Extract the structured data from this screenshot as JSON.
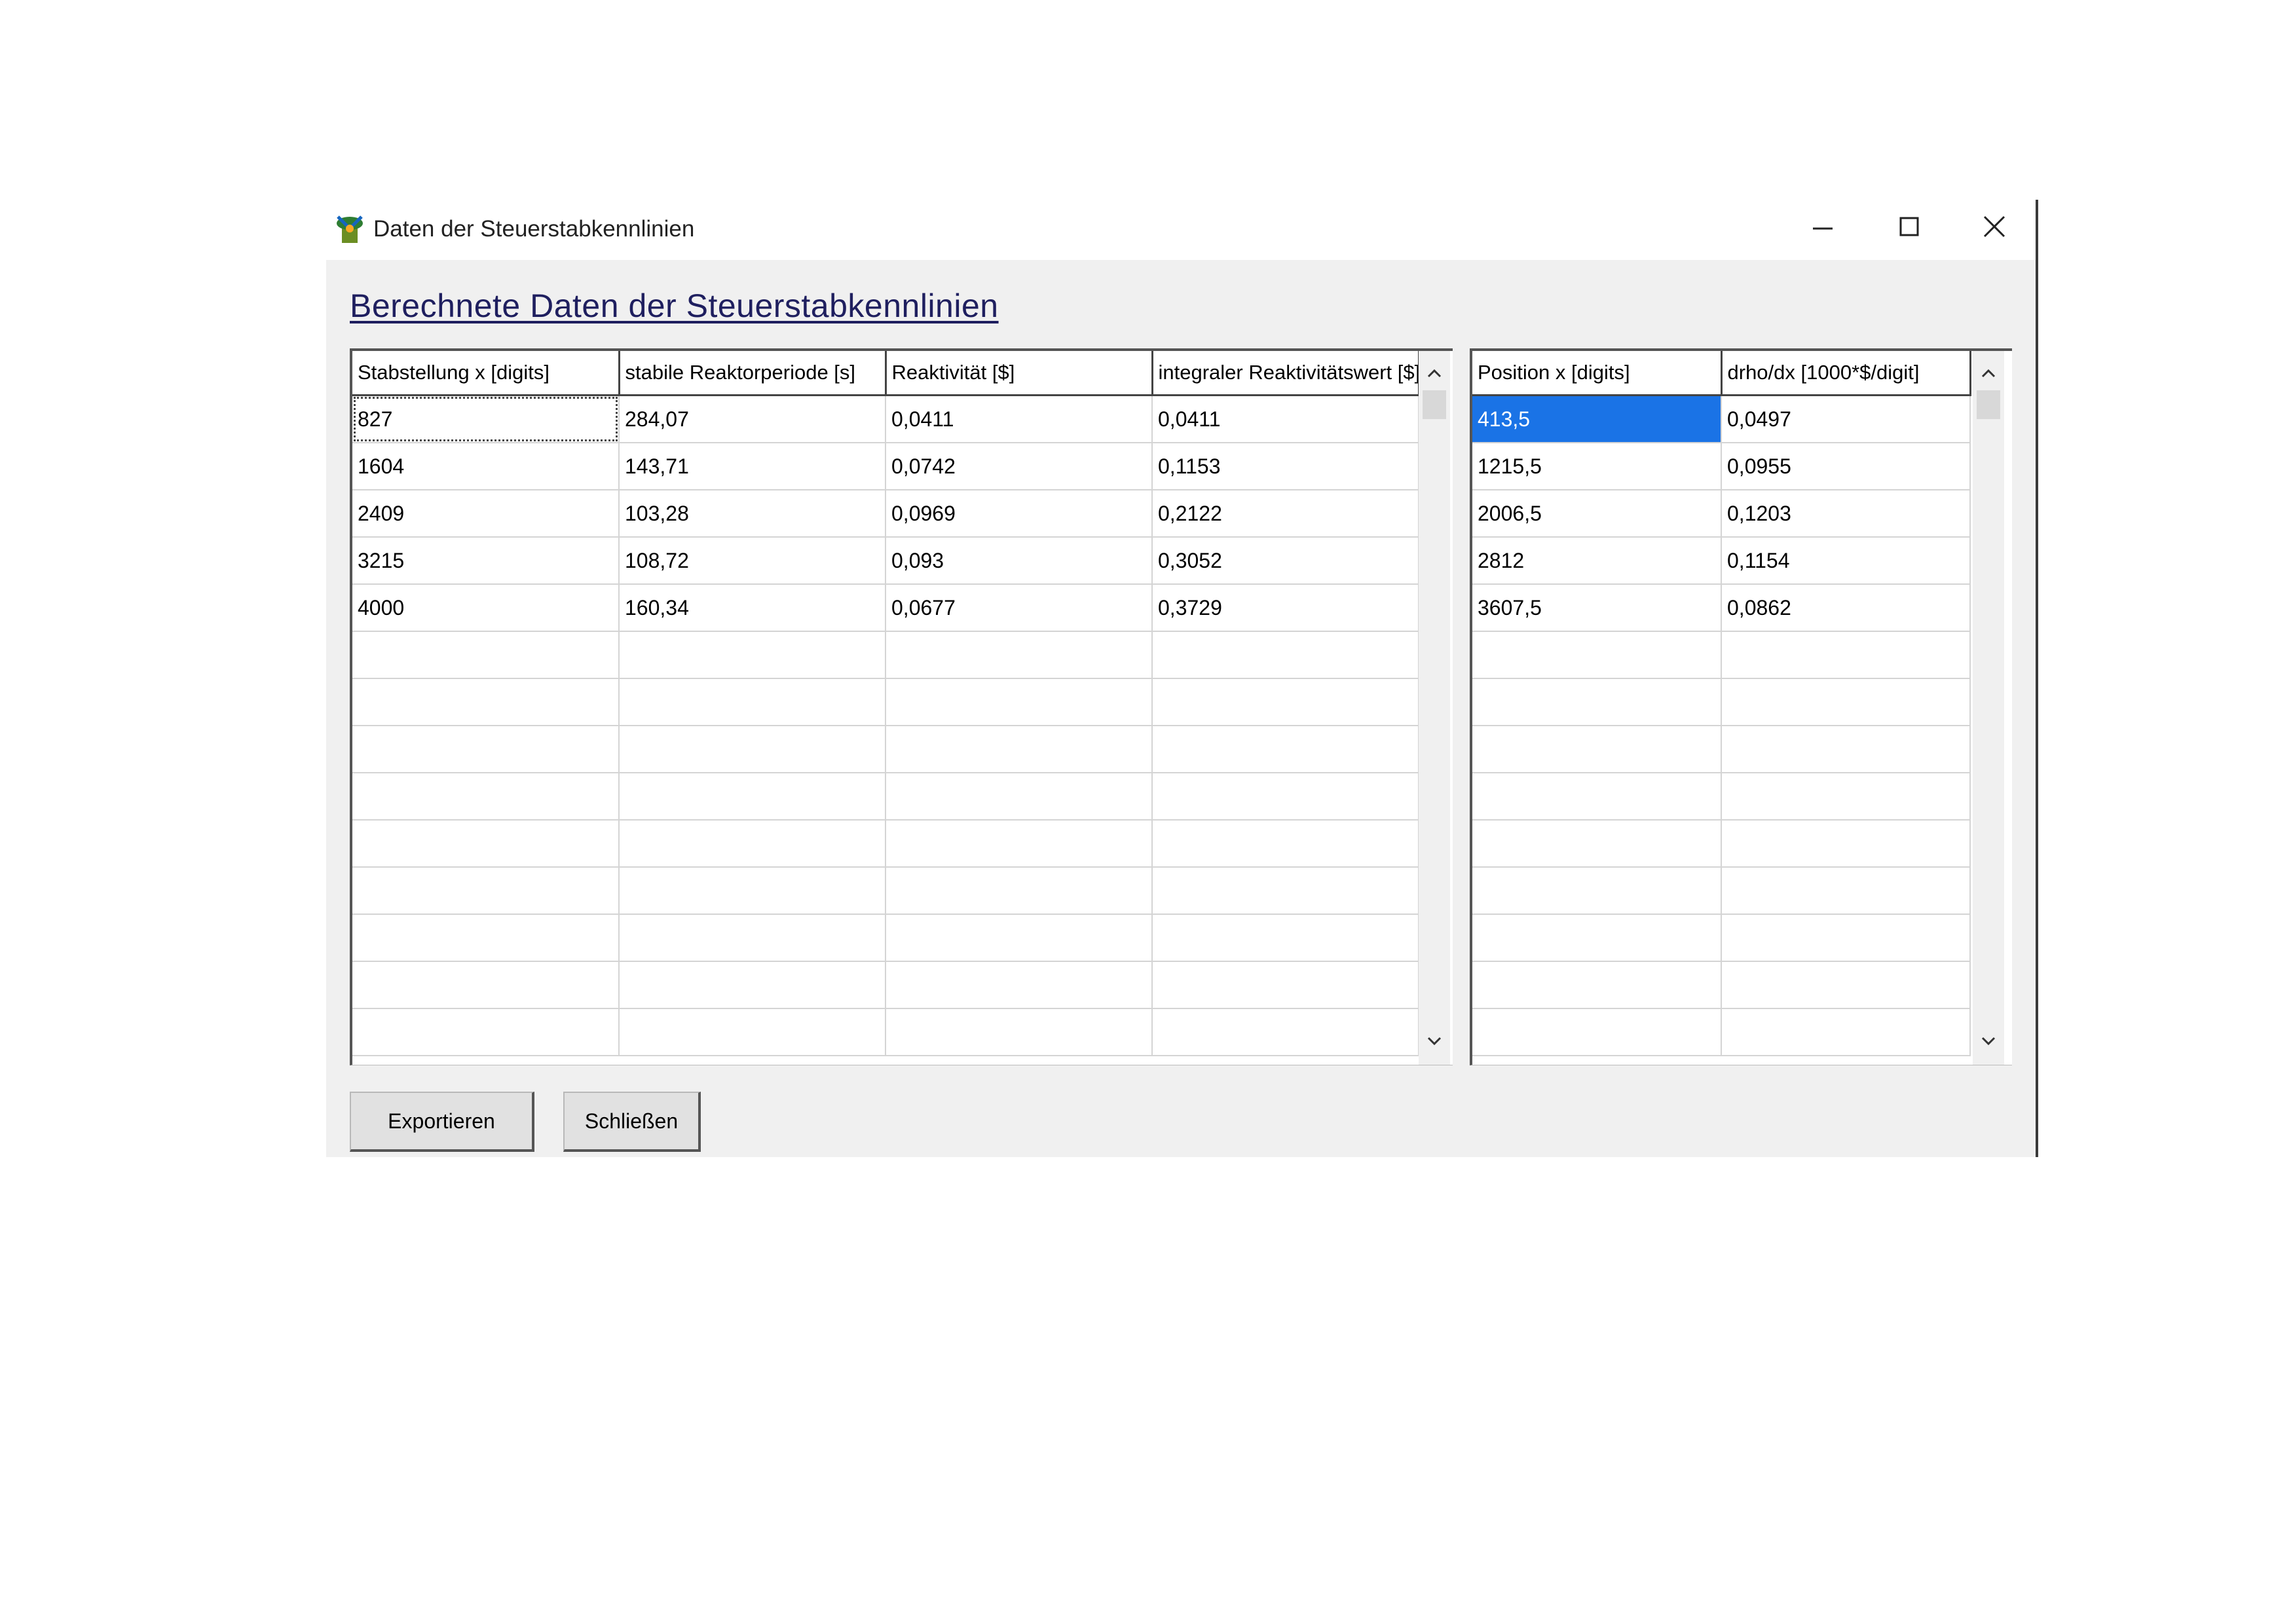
{
  "window": {
    "title": "Daten der Steuerstabkennlinien",
    "icon": "reactor-app-icon",
    "controls": [
      "minimize-icon",
      "maximize-icon",
      "close-icon"
    ]
  },
  "heading": "Berechnete Daten der Steuerstabkennlinien",
  "left_table": {
    "headers": [
      "Stabstellung x [digits]",
      "stabile Reaktorperiode [s]",
      "Reaktivität [$]",
      "integraler Reaktivitätswert [$]"
    ],
    "rows": [
      [
        "827",
        "284,07",
        "0,0411",
        "0,0411"
      ],
      [
        "1604",
        "143,71",
        "0,0742",
        "0,1153"
      ],
      [
        "2409",
        "103,28",
        "0,0969",
        "0,2122"
      ],
      [
        "3215",
        "108,72",
        "0,093",
        "0,3052"
      ],
      [
        "4000",
        "160,34",
        "0,0677",
        "0,3729"
      ]
    ],
    "focused_cell": [
      0,
      0
    ]
  },
  "right_table": {
    "headers": [
      "Position x [digits]",
      "drho/dx [1000*$/digit]"
    ],
    "rows": [
      [
        "413,5",
        "0,0497"
      ],
      [
        "1215,5",
        "0,0955"
      ],
      [
        "2006,5",
        "0,1203"
      ],
      [
        "2812",
        "0,1154"
      ],
      [
        "3607,5",
        "0,0862"
      ]
    ],
    "selected_cell": [
      0,
      0
    ]
  },
  "buttons": {
    "export": "Exportieren",
    "close": "Schließen"
  },
  "colors": {
    "selection": "#1a73e6",
    "heading": "#1f1f5f"
  }
}
